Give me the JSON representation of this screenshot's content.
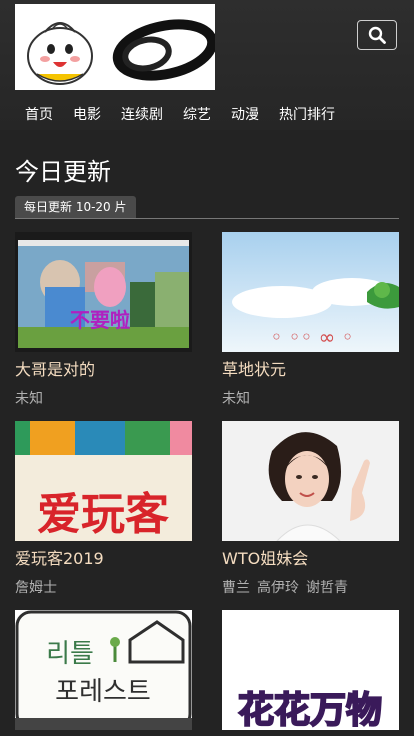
{
  "header": {
    "nav": [
      "首页",
      "电影",
      "连续剧",
      "综艺",
      "动漫",
      "热门排行"
    ]
  },
  "section": {
    "title": "今日更新",
    "tag": "每日更新 10-20 片"
  },
  "cards": [
    {
      "title": "大哥是对的",
      "meta": [
        "未知"
      ],
      "thumb_text": "不要啦"
    },
    {
      "title": "草地状元",
      "meta": [
        "未知"
      ]
    },
    {
      "title": "爱玩客2019",
      "meta": [
        "詹姆士"
      ],
      "thumb_text": "爱玩客"
    },
    {
      "title": "WTO姐妹会",
      "meta": [
        "曹兰",
        "高伊玲",
        "谢哲青"
      ]
    },
    {
      "title": "",
      "meta": [],
      "thumb_text": "리틀 포레스트"
    },
    {
      "title": "",
      "meta": [],
      "thumb_text": "花花万物"
    }
  ],
  "icons": {
    "search": "search-icon"
  }
}
